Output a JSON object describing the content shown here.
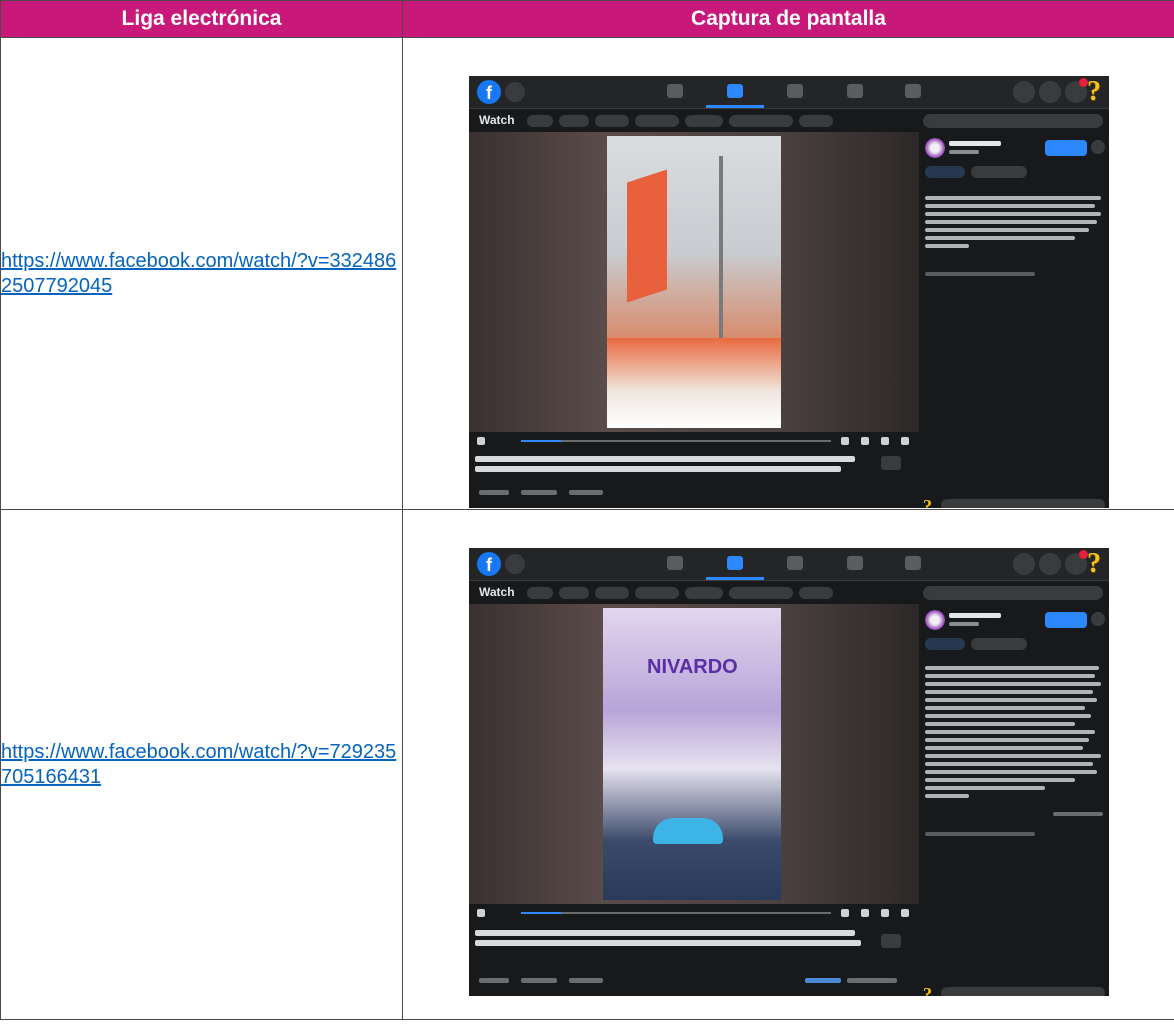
{
  "table": {
    "header": {
      "link_col": "Liga electrónica",
      "capture_col": "Captura de pantalla"
    },
    "rows": [
      {
        "link_line1": "https://www.facebook.com/wat",
        "link_line2": "ch/?v=3324862507792045",
        "screenshot": {
          "app": "Watch",
          "frame_color": "#e8603c"
        }
      },
      {
        "link_line1": "https://www.facebook.com/wat",
        "link_line2": "ch/?v=729235705166431",
        "screenshot": {
          "app": "Watch",
          "banner": "NIVARDO",
          "frame_color": "#5b2ea6"
        }
      }
    ]
  },
  "colors": {
    "header_bg": "#c8187a",
    "link": "#0563c1",
    "fb_dark": "#18191a",
    "fb_blue": "#1877f2"
  },
  "icons": [
    "facebook-logo-icon",
    "search-icon",
    "home-icon",
    "watch-icon",
    "marketplace-icon",
    "groups-icon",
    "gaming-icon",
    "menu-grid-icon",
    "messenger-icon",
    "notifications-icon",
    "play-icon",
    "settings-icon"
  ]
}
